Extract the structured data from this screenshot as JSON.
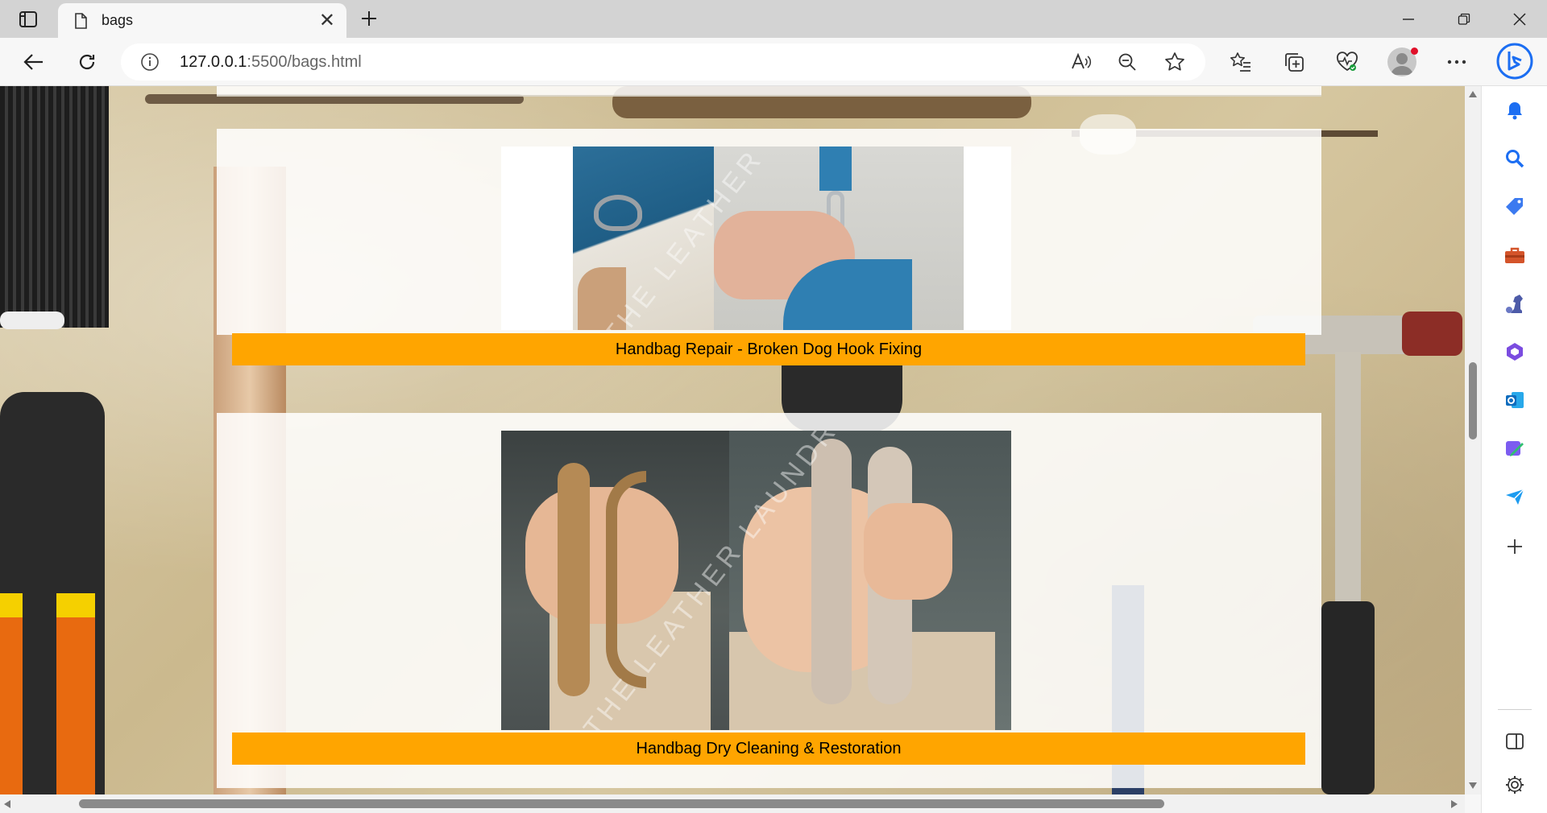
{
  "browser": {
    "tab": {
      "title": "bags"
    },
    "address": {
      "host": "127.0.0.1",
      "path": ":5500/bags.html"
    }
  },
  "page": {
    "cards": [
      {
        "caption": "Handbag Repair - Broken Dog Hook Fixing"
      },
      {
        "caption": "Handbag Dry Cleaning & Restoration"
      }
    ],
    "watermark": "THE LEATHER LAUNDRY"
  },
  "colors": {
    "caption_bg": "#ffa500",
    "tab_strip": "#d3d3d3",
    "bing_blue": "#1c6ef2"
  },
  "icons": {
    "sidebar": [
      "bell-icon",
      "search-icon",
      "tag-icon",
      "briefcase-icon",
      "chess-icon",
      "office-icon",
      "outlook-icon",
      "designer-icon",
      "send-icon",
      "add-icon",
      "split-screen-icon",
      "settings-icon"
    ]
  }
}
